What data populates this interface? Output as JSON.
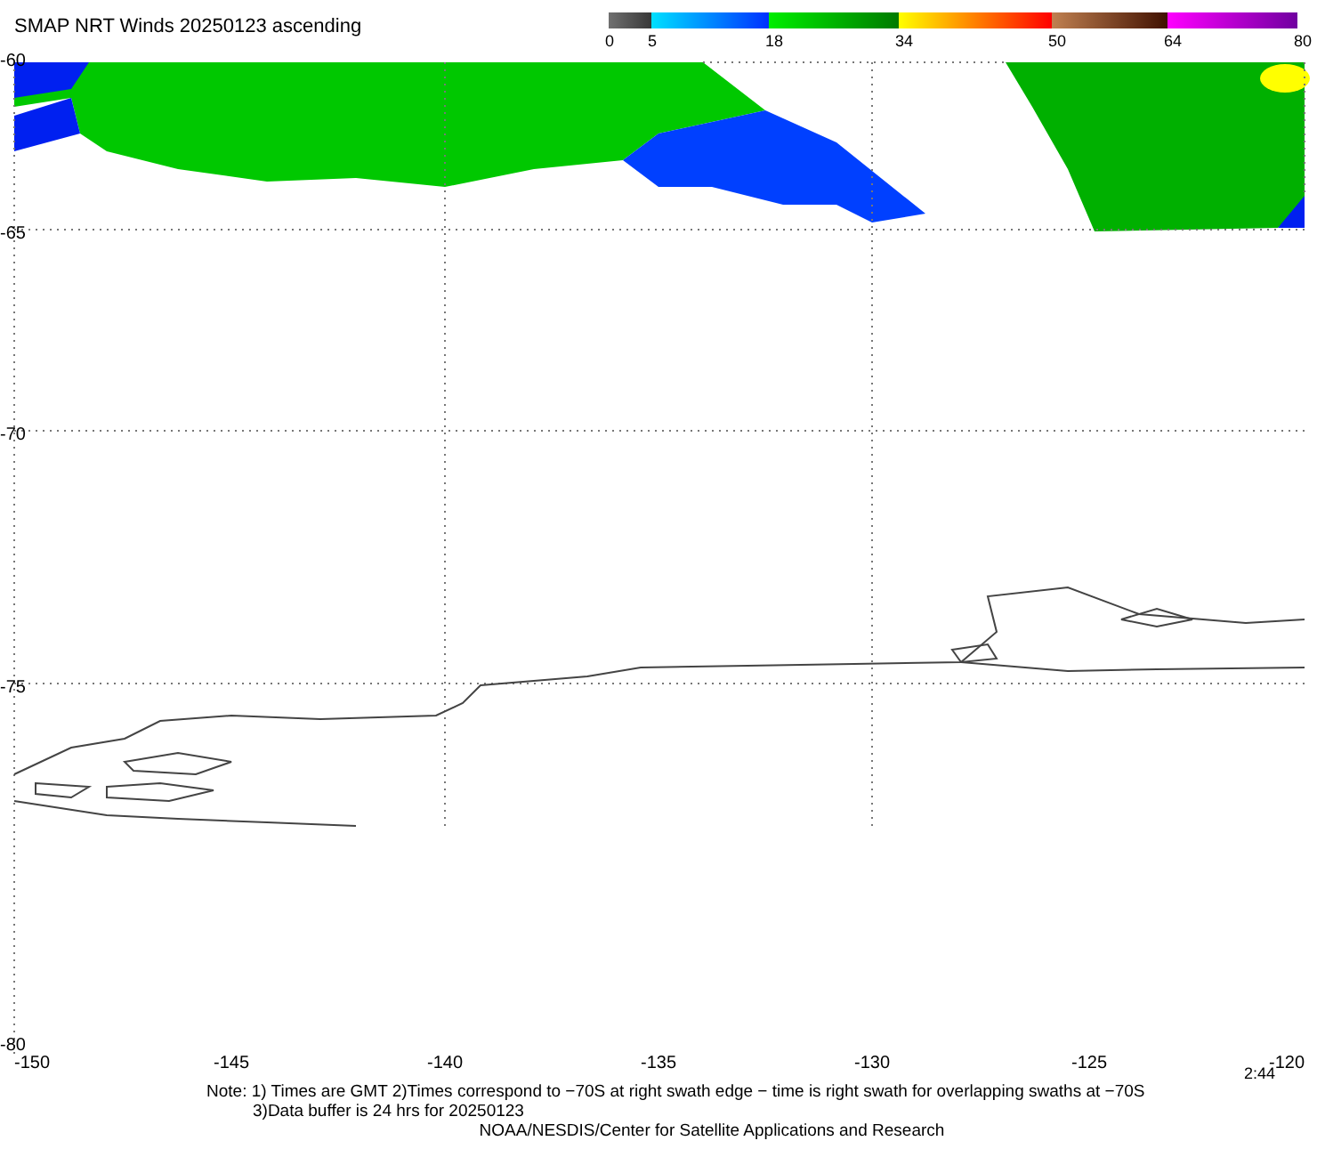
{
  "title": "SMAP NRT Winds 20250123 ascending",
  "colorbar": {
    "ticks": [
      "0",
      "5",
      "18",
      "34",
      "50",
      "64",
      "80"
    ]
  },
  "map": {
    "lat_labels": [
      "-60",
      "-65",
      "-70",
      "-75",
      "-80"
    ],
    "lon_labels": [
      "-150",
      "-145",
      "-140",
      "-135",
      "-130",
      "-125",
      "-120"
    ],
    "time_label": "2:44"
  },
  "notes": [
    "Note: 1) Times are GMT 2)Times correspond to −70S at right swath edge − time is right swath for overlapping swaths at −70S",
    "3)Data buffer is 24 hrs for 20250123"
  ],
  "credit": "NOAA/NESDIS/Center for Satellite Applications and Research"
}
